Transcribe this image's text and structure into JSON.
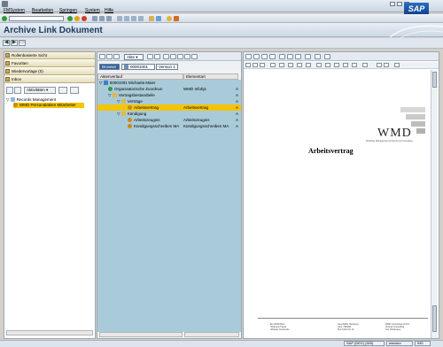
{
  "menu": [
    "FMSystem",
    "Bearbeiten",
    "Springen",
    "System",
    "Hilfe"
  ],
  "title": "Archive Link Dokument",
  "left_panel": {
    "roles": [
      {
        "label": "Rollenbasierte Sicht"
      },
      {
        "label": "Favoriten"
      },
      {
        "label": "Wiedervorlage (0)"
      },
      {
        "label": "Inbox"
      }
    ],
    "tools": {
      "activities_label": "Aktivitäten"
    },
    "tree": [
      {
        "label": "Records Management"
      },
      {
        "label": "WMD Personalakten Mitarbeiter"
      }
    ]
  },
  "middle_panel": {
    "tabs": {
      "browser": "Browser",
      "path": "00001001",
      "version": "Version 1"
    },
    "menu_btn": "Akte",
    "columns": {
      "attribute": "Aktenverlauf",
      "type": "Elementart"
    },
    "rows": [
      {
        "label": "00001001 Michaela Maier",
        "type": "",
        "flag": ""
      },
      {
        "label": "Organisatorische Zuordnun",
        "type": "WMD Infobjs",
        "flag": "A"
      },
      {
        "label": "Vertragsbestandteile",
        "type": "",
        "flag": "A"
      },
      {
        "label": "Verträge",
        "type": "",
        "flag": "A"
      },
      {
        "label": "Arbeitsvertrag",
        "type": "Arbeitsvertrag",
        "flag": "A"
      },
      {
        "label": "Kündigung",
        "type": "",
        "flag": "A"
      },
      {
        "label": "Arbeitszeugnis",
        "type": "Arbeitszeugnis",
        "flag": "A"
      },
      {
        "label": "Kündigungsschreiben MA",
        "type": "Kündigungsschreiben MA",
        "flag": "A"
      }
    ]
  },
  "document": {
    "logo_text": "WMD",
    "logo_subtitle": "Workflow Management & Document Consulting",
    "heading": "Arbeitsvertrag",
    "footer_cols": [
      [
        "Ein WMD Büro",
        "Hoffmann Haupt",
        "Affraulie Cudmerde"
      ],
      [
        "Geschäftsf. Beratung",
        "Jobs, HR/RM",
        "PLZ 1234 Ort 12"
      ],
      [
        "WMD Consulting GmbH",
        "Vertrieb Consulting",
        "Ost: Bürokraten"
      ]
    ]
  },
  "status": {
    "system": "SAP (DEV) (300)",
    "server": "wmdsrv",
    "mode": "INS"
  },
  "colors": {
    "selection": "#f5c400",
    "grid": "#a9cbd9",
    "title": "#1c3a5e"
  }
}
